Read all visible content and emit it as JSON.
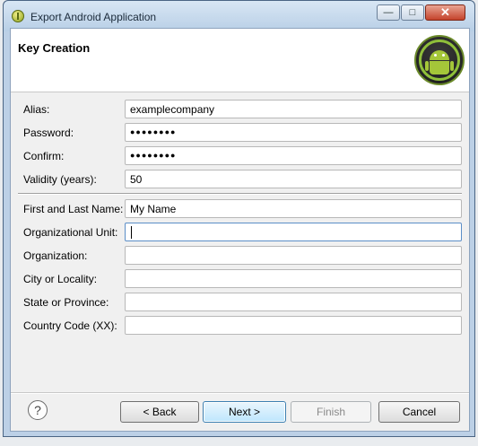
{
  "window": {
    "title": "Export Android Application",
    "minimize_glyph": "—",
    "maximize_glyph": "□",
    "close_glyph": "✕"
  },
  "header": {
    "title": "Key Creation",
    "logo_icon": "android-robot-icon"
  },
  "key_fields": [
    {
      "label": "Alias:",
      "value": "examplecompany"
    },
    {
      "label": "Password:",
      "value": "●●●●●●●●"
    },
    {
      "label": "Confirm:",
      "value": "●●●●●●●●"
    },
    {
      "label": "Validity (years):",
      "value": "50"
    }
  ],
  "dn_fields": [
    {
      "label": "First and Last Name:",
      "value": "My Name"
    },
    {
      "label": "Organizational Unit:",
      "value": ""
    },
    {
      "label": "Organization:",
      "value": ""
    },
    {
      "label": "City or Locality:",
      "value": ""
    },
    {
      "label": "State or Province:",
      "value": ""
    },
    {
      "label": "Country Code (XX):",
      "value": ""
    }
  ],
  "buttons": {
    "help": "?",
    "back": "< Back",
    "next": "Next >",
    "finish": "Finish",
    "cancel": "Cancel"
  },
  "colors": {
    "title_bar": "#c4d7eb",
    "default_button": "#3c7fb1",
    "android_green": "#a4c639"
  }
}
